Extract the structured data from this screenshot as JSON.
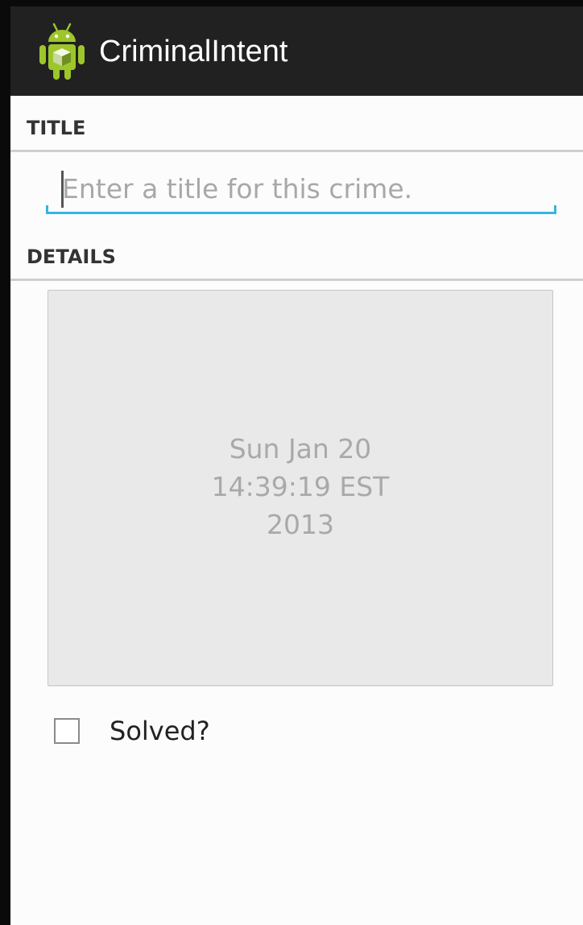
{
  "action_bar": {
    "title": "CriminalIntent",
    "icon": "android-robot-icon"
  },
  "sections": {
    "title_header": "TITLE",
    "details_header": "DETAILS"
  },
  "title_input": {
    "placeholder": "Enter a title for this crime.",
    "value": ""
  },
  "date_button": {
    "label": "Sun Jan 20\n14:39:19 EST\n2013"
  },
  "solved": {
    "label": "Solved?",
    "checked": false
  },
  "colors": {
    "action_bar_bg": "#212121",
    "input_underline": "#33b5e5",
    "date_button_bg": "#e9e9e9",
    "date_text": "#a9a9a9"
  }
}
